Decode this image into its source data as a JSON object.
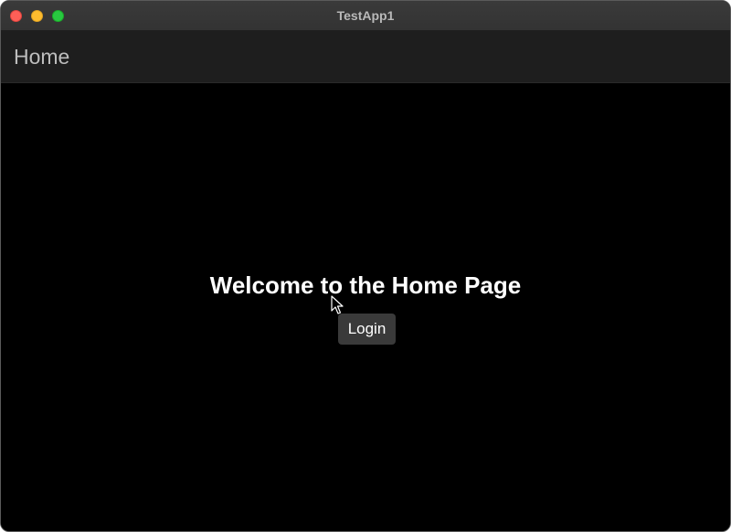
{
  "window": {
    "title": "TestApp1"
  },
  "appbar": {
    "title": "Home"
  },
  "main": {
    "heading": "Welcome to the Home Page",
    "login_label": "Login"
  },
  "colors": {
    "background": "#000000",
    "appbar": "#1e1e1e",
    "button": "#3a3a3a",
    "close": "#fe5f57",
    "minimize": "#febc2e",
    "maximize": "#28c840"
  },
  "icons": {
    "close": "close-icon",
    "minimize": "minimize-icon",
    "maximize": "maximize-icon",
    "cursor": "mouse-pointer-icon"
  }
}
